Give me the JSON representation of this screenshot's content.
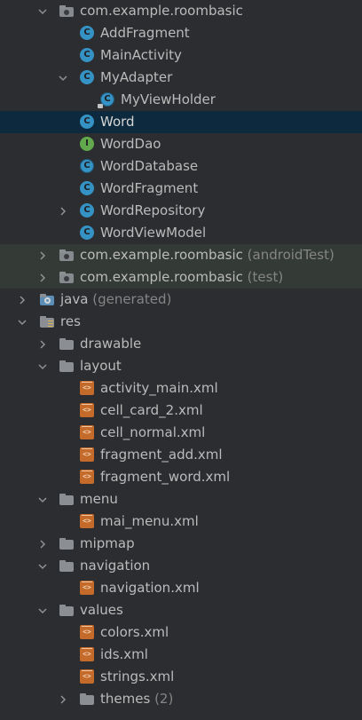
{
  "tree": {
    "rows": [
      {
        "id": "pkg-main",
        "label": "com.example.roombasic",
        "suffix": "",
        "icon": "package-folder-icon",
        "expanded": true,
        "depth": 1
      },
      {
        "id": "addfragment",
        "label": "AddFragment",
        "icon": "class-icon",
        "depth": 2
      },
      {
        "id": "mainactivity",
        "label": "MainActivity",
        "icon": "class-icon",
        "depth": 2
      },
      {
        "id": "myadapter",
        "label": "MyAdapter",
        "icon": "class-icon",
        "expanded": true,
        "depth": 2
      },
      {
        "id": "myviewholder",
        "label": "MyViewHolder",
        "icon": "abstract-class-icon",
        "depth": 3
      },
      {
        "id": "word",
        "label": "Word",
        "icon": "class-icon",
        "selected": true,
        "depth": 2
      },
      {
        "id": "worddao",
        "label": "WordDao",
        "icon": "interface-icon",
        "depth": 2
      },
      {
        "id": "worddatabase",
        "label": "WordDatabase",
        "icon": "abstract-class-icon",
        "depth": 2
      },
      {
        "id": "wordfragment",
        "label": "WordFragment",
        "icon": "class-icon",
        "depth": 2
      },
      {
        "id": "wordrepository",
        "label": "WordRepository",
        "icon": "class-icon",
        "collapsed": true,
        "depth": 2
      },
      {
        "id": "wordviewmodel",
        "label": "WordViewModel",
        "icon": "class-icon",
        "depth": 2
      },
      {
        "id": "pkg-androidtest",
        "label": "com.example.roombasic",
        "suffix": "(androidTest)",
        "icon": "package-folder-icon",
        "collapsed": true,
        "depth": 1
      },
      {
        "id": "pkg-test",
        "label": "com.example.roombasic",
        "suffix": "(test)",
        "icon": "package-folder-icon",
        "collapsed": true,
        "depth": 1
      },
      {
        "id": "java-generated",
        "label": "java",
        "suffix": "(generated)",
        "icon": "generated-folder-icon",
        "collapsed": true,
        "depth": 0
      },
      {
        "id": "res",
        "label": "res",
        "icon": "resource-folder-icon",
        "expanded": true,
        "depth": 0
      },
      {
        "id": "drawable",
        "label": "drawable",
        "icon": "folder-icon",
        "collapsed": true,
        "depth": 1
      },
      {
        "id": "layout",
        "label": "layout",
        "icon": "folder-icon",
        "expanded": true,
        "depth": 1
      },
      {
        "id": "activity_main",
        "label": "activity_main.xml",
        "icon": "xml-file-icon",
        "depth": 2
      },
      {
        "id": "cell_card_2",
        "label": "cell_card_2.xml",
        "icon": "xml-file-icon",
        "depth": 2
      },
      {
        "id": "cell_normal",
        "label": "cell_normal.xml",
        "icon": "xml-file-icon",
        "depth": 2
      },
      {
        "id": "fragment_add",
        "label": "fragment_add.xml",
        "icon": "xml-file-icon",
        "depth": 2
      },
      {
        "id": "fragment_word",
        "label": "fragment_word.xml",
        "icon": "xml-file-icon",
        "depth": 2
      },
      {
        "id": "menu",
        "label": "menu",
        "icon": "folder-icon",
        "expanded": true,
        "depth": 1
      },
      {
        "id": "mai_menu",
        "label": "mai_menu.xml",
        "icon": "xml-file-icon",
        "depth": 2
      },
      {
        "id": "mipmap",
        "label": "mipmap",
        "icon": "folder-icon",
        "collapsed": true,
        "depth": 1
      },
      {
        "id": "navigation",
        "label": "navigation",
        "icon": "folder-icon",
        "expanded": true,
        "depth": 1
      },
      {
        "id": "navigation_xml",
        "label": "navigation.xml",
        "icon": "xml-file-icon",
        "depth": 2
      },
      {
        "id": "values",
        "label": "values",
        "icon": "folder-icon",
        "expanded": true,
        "depth": 1
      },
      {
        "id": "colors",
        "label": "colors.xml",
        "icon": "xml-file-icon",
        "depth": 2
      },
      {
        "id": "ids",
        "label": "ids.xml",
        "icon": "xml-file-icon",
        "depth": 2
      },
      {
        "id": "strings",
        "label": "strings.xml",
        "icon": "xml-file-icon",
        "depth": 2
      },
      {
        "id": "themes",
        "label": "themes",
        "suffix": "(2)",
        "icon": "folder-icon",
        "collapsed": true,
        "depth": 2
      }
    ]
  },
  "colors": {
    "background": "#2b2d30",
    "selection": "#0d293e",
    "test_folder_bg": "#343b36",
    "class_icon": "#3592c4",
    "interface_icon": "#62a94d",
    "xml_icon": "#c46a2a"
  }
}
